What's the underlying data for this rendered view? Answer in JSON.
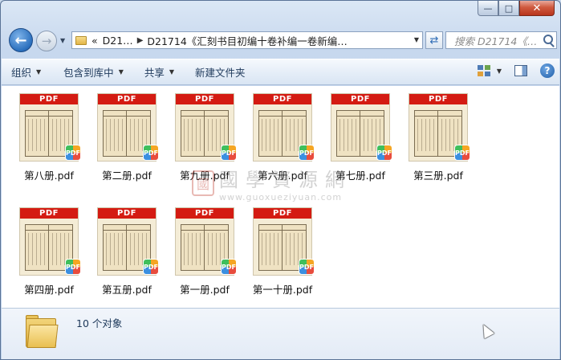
{
  "window": {
    "caption_buttons": {
      "minimize": "—",
      "maximize": "□",
      "close": "✕"
    }
  },
  "nav": {
    "back_symbol": "←",
    "forward_symbol": "→",
    "address": {
      "prefix": "«",
      "crumb_parent": "D21…",
      "crumb_current": "D21714《汇刻书目初编十卷补编一卷新编…"
    },
    "search_placeholder": "搜索 D21714《…"
  },
  "toolbar": {
    "organize": "组织",
    "include_in_library": "包含到库中",
    "share": "共享",
    "new_folder": "新建文件夹"
  },
  "watermark": {
    "seal_text": "國",
    "name": "國學資源網",
    "url": "www.guoxueziyuan.com"
  },
  "files": [
    {
      "thumb_label": "PDF",
      "badge": "PDF",
      "name": "第八册.pdf"
    },
    {
      "thumb_label": "PDF",
      "badge": "PDF",
      "name": "第二册.pdf"
    },
    {
      "thumb_label": "PDF",
      "badge": "PDF",
      "name": "第九册.pdf"
    },
    {
      "thumb_label": "PDF",
      "badge": "PDF",
      "name": "第六册.pdf"
    },
    {
      "thumb_label": "PDF",
      "badge": "PDF",
      "name": "第七册.pdf"
    },
    {
      "thumb_label": "PDF",
      "badge": "PDF",
      "name": "第三册.pdf"
    },
    {
      "thumb_label": "PDF",
      "badge": "PDF",
      "name": "第四册.pdf"
    },
    {
      "thumb_label": "PDF",
      "badge": "PDF",
      "name": "第五册.pdf"
    },
    {
      "thumb_label": "PDF",
      "badge": "PDF",
      "name": "第一册.pdf"
    },
    {
      "thumb_label": "PDF",
      "badge": "PDF",
      "name": "第一十册.pdf"
    }
  ],
  "status": {
    "count_text": "10 个对象"
  },
  "icons": {
    "folder": "folder-icon",
    "search": "search-icon",
    "refresh": "refresh-icon",
    "help": "help-icon",
    "view": "view-options-icon",
    "preview_pane": "preview-pane-icon"
  }
}
